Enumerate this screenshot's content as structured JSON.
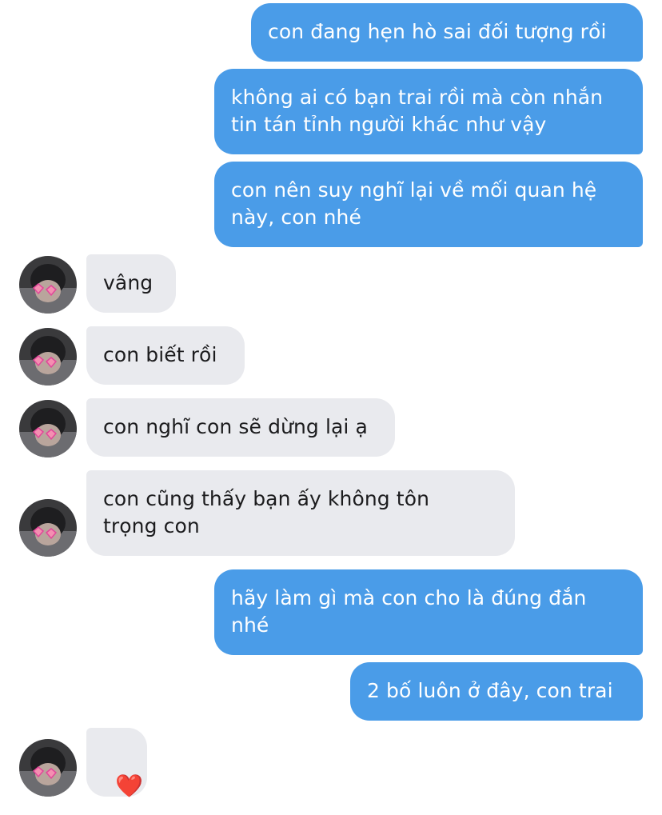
{
  "messages": [
    {
      "side": "out",
      "text": "con đang hẹn hò sai đối tượng rồi"
    },
    {
      "side": "out",
      "text": "không ai có bạn trai rồi mà còn nhắn\ntin tán tỉnh người khác như vậy"
    },
    {
      "side": "out",
      "text": "con nên suy nghĩ lại về mối quan hệ\nnày, con nhé"
    },
    {
      "side": "in",
      "text": "vâng"
    },
    {
      "side": "in",
      "text": "con biết rồi"
    },
    {
      "side": "in",
      "text": "con nghĩ con sẽ dừng lại ạ"
    },
    {
      "side": "in",
      "text": "con cũng thấy bạn ấy không tôn\ntrọng con"
    },
    {
      "side": "out",
      "text": "hãy làm gì mà con cho là đúng đắn\nnhé"
    },
    {
      "side": "out",
      "text": "2 bố luôn ở đây, con trai"
    },
    {
      "side": "in",
      "text": "❤️"
    }
  ],
  "colors": {
    "outgoing_bubble": "#4a9ce8",
    "incoming_bubble": "#e9eaee",
    "heart": "#e0303a"
  }
}
